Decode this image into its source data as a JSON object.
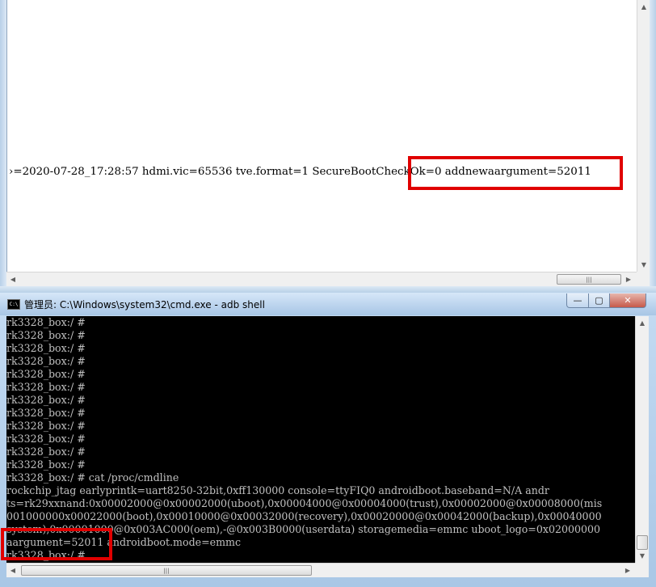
{
  "top_window": {
    "text_line": "›=2020-07-28_17:28:57 hdmi.vic=65536 tve.format=1 SecureBootCheckOk=0 addnewaargument=52011"
  },
  "cmd_window": {
    "icon_text": "C:\\",
    "title": "管理员: C:\\Windows\\system32\\cmd.exe - adb  shell",
    "caption": {
      "minimize": "—",
      "maximize": "▢",
      "close": "✕"
    },
    "lines": [
      "rk3328_box:/ #",
      "rk3328_box:/ #",
      "rk3328_box:/ #",
      "rk3328_box:/ #",
      "rk3328_box:/ #",
      "rk3328_box:/ #",
      "rk3328_box:/ #",
      "rk3328_box:/ #",
      "rk3328_box:/ #",
      "rk3328_box:/ #",
      "rk3328_box:/ #",
      "rk3328_box:/ #",
      "rk3328_box:/ # cat /proc/cmdline",
      "rockchip_jtag earlyprintk=uart8250-32bit,0xff130000 console=ttyFIQ0 androidboot.baseband=N/A andr",
      "ts=rk29xxnand:0x00002000@0x00002000(uboot),0x00004000@0x00004000(trust),0x00002000@0x00008000(mis",
      "001000000x00022000(boot),0x00010000@0x00032000(recovery),0x00020000@0x00042000(backup),0x00040000",
      "system),0x00001000@0x003AC000(oem),-@0x003B0000(userdata) storagemedia=emmc uboot_logo=0x02000000",
      "aargument=52011 androidboot.mode=emmc",
      "rk3328_box:/ #"
    ]
  },
  "scroll": {
    "up": "▲",
    "down": "▼",
    "left": "◀",
    "right": "▶",
    "grip": "|||"
  },
  "colors": {
    "highlight": "#e00000",
    "console_bg": "#000000",
    "console_fg": "#c0c0c0"
  }
}
